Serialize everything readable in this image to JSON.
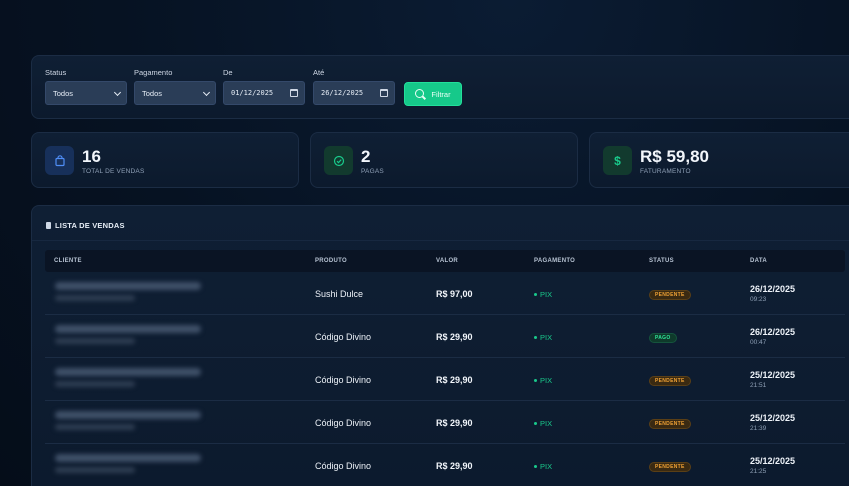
{
  "filters": {
    "status": {
      "label": "Status",
      "value": "Todos"
    },
    "pagamento": {
      "label": "Pagamento",
      "value": "Todos"
    },
    "de": {
      "label": "De",
      "value": "01/12/2025"
    },
    "ate": {
      "label": "Até",
      "value": "26/12/2025"
    },
    "button_label": "Filtrar"
  },
  "stats": [
    {
      "value": "16",
      "label": "TOTAL DE VENDAS",
      "icon": "shopping-bag-icon",
      "color": "#3b82f6"
    },
    {
      "value": "2",
      "label": "PAGAS",
      "icon": "check-circle-icon",
      "color": "#19c98b"
    },
    {
      "value": "R$ 59,80",
      "label": "FATURAMENTO",
      "icon": "dollar-icon",
      "color": "#19c98b"
    }
  ],
  "list": {
    "title": "LISTA DE VENDAS",
    "columns": [
      "CLIENTE",
      "PRODUTO",
      "VALOR",
      "PAGAMENTO",
      "STATUS",
      "DATA"
    ],
    "rows": [
      {
        "produto": "Sushi Dulce",
        "valor": "R$ 97,00",
        "pagamento": "PIX",
        "status": "PENDENTE",
        "data": "26/12/2025",
        "hora": "09:23"
      },
      {
        "produto": "Código Divino",
        "valor": "R$ 29,90",
        "pagamento": "PIX",
        "status": "PAGO",
        "data": "26/12/2025",
        "hora": "00:47"
      },
      {
        "produto": "Código Divino",
        "valor": "R$ 29,90",
        "pagamento": "PIX",
        "status": "PENDENTE",
        "data": "25/12/2025",
        "hora": "21:51"
      },
      {
        "produto": "Código Divino",
        "valor": "R$ 29,90",
        "pagamento": "PIX",
        "status": "PENDENTE",
        "data": "25/12/2025",
        "hora": "21:39"
      },
      {
        "produto": "Código Divino",
        "valor": "R$ 29,90",
        "pagamento": "PIX",
        "status": "PENDENTE",
        "data": "25/12/2025",
        "hora": "21:25"
      }
    ]
  },
  "colors": {
    "accent": "#16c98a",
    "pending": "#f0a235",
    "paid": "#2ee69a",
    "background": "#06101e"
  }
}
